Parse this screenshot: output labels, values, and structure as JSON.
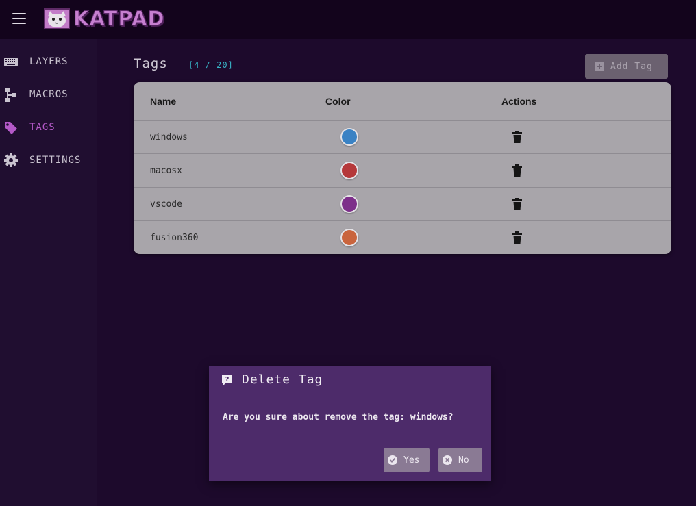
{
  "app": {
    "name": "KATPAD"
  },
  "sidebar": {
    "items": [
      {
        "label": "LAYERS",
        "icon": "keyboard-icon",
        "active": false
      },
      {
        "label": "MACROS",
        "icon": "sitemap-icon",
        "active": false
      },
      {
        "label": "TAGS",
        "icon": "tags-icon",
        "active": true
      },
      {
        "label": "SETTINGS",
        "icon": "gear-icon",
        "active": false
      }
    ]
  },
  "main": {
    "title": "Tags",
    "count": "[4 / 20]",
    "add_label": "Add Tag",
    "table": {
      "headers": [
        "Name",
        "Color",
        "Actions"
      ],
      "rows": [
        {
          "name": "windows",
          "color": "#3a82c4"
        },
        {
          "name": "macosx",
          "color": "#b5383a"
        },
        {
          "name": "vscode",
          "color": "#7d2f8a"
        },
        {
          "name": "fusion360",
          "color": "#c9643d"
        }
      ]
    }
  },
  "dialog": {
    "title": "Delete Tag",
    "message": "Are you sure about remove the tag: windows?",
    "yes_label": "Yes",
    "no_label": "No"
  },
  "colors": {
    "accent": "#b459c8",
    "dialog_bg": "#4d2b6a",
    "count": "#38b4c6"
  }
}
